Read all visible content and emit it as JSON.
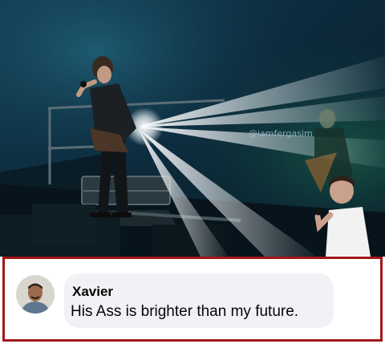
{
  "photo": {
    "watermark": "@iamfergasim"
  },
  "comment": {
    "author": "Xavier",
    "text": "His Ass is brighter than my future."
  },
  "colors": {
    "frame_border": "#a3161a",
    "bubble_bg": "#f0f2f5",
    "text": "#050505"
  }
}
